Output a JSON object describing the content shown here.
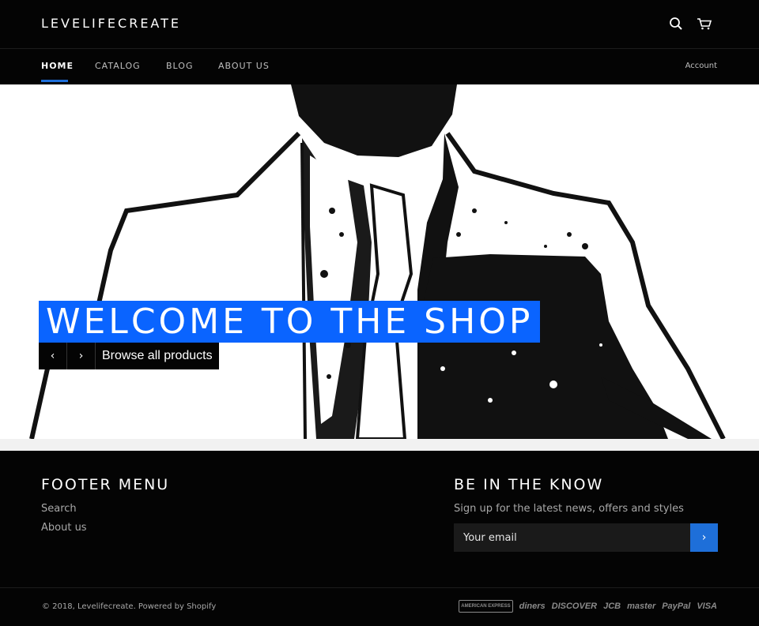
{
  "header": {
    "logo": "LEVELIFECREATE",
    "search_icon": "search-icon",
    "cart_icon": "cart-icon"
  },
  "nav": {
    "items": [
      {
        "label": "HOME",
        "active": true
      },
      {
        "label": "CATALOG",
        "active": false
      },
      {
        "label": "BLOG",
        "active": false
      },
      {
        "label": "ABOUT US",
        "active": false
      }
    ],
    "account": "Account"
  },
  "hero": {
    "title": "WELCOME TO THE SHOP",
    "prev_icon": "chevron-left-icon",
    "next_icon": "chevron-right-icon",
    "prev_glyph": "‹",
    "next_glyph": "›",
    "cta": "Browse all products"
  },
  "footer": {
    "menu_title": "FOOTER MENU",
    "menu_links": [
      "Search",
      "About us"
    ],
    "newsletter_title": "BE IN THE KNOW",
    "newsletter_sub": "Sign up for the latest news, offers and styles",
    "email_placeholder": "Your email",
    "submit_glyph": "›",
    "copyright": "© 2018, Levelifecreate. Powered by Shopify",
    "payments": [
      "AMERICAN EXPRESS",
      "diners",
      "DISCOVER",
      "JCB",
      "master",
      "PayPal",
      "VISA"
    ]
  },
  "colors": {
    "accent": "#1e6fd9",
    "hero_title_bg": "#0a64ff",
    "bar_bg": "#040404"
  }
}
